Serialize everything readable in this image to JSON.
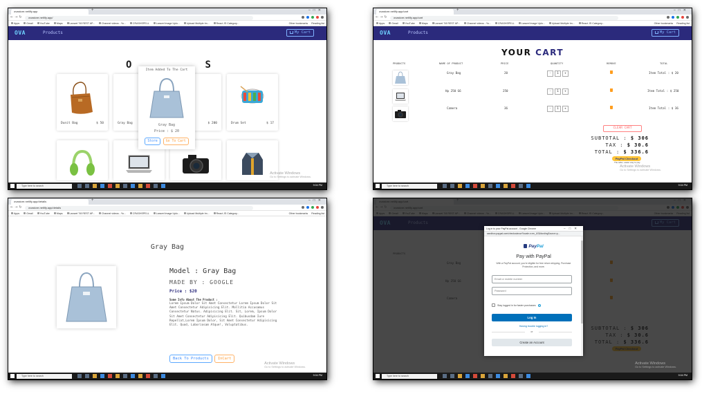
{
  "browser": {
    "tab_title_p1": "ovastore.netlify.app",
    "tab_title_p2": "ovastore.netlify.app/cart",
    "tab_title_p3": "ovastore.netlify.app/details",
    "url_p1": "ovastore.netlify.app/",
    "url_p2": "ovastore.netlify.app/cart",
    "url_p3": "ovastore.netlify.app/details",
    "url_p4": "ovastore.netlify.app/cart",
    "bookmarks": [
      "Apps",
      "Gmail",
      "YouTube",
      "Maps",
      "Laravel 7/8 REST AP...",
      "Channel videos - Yo...",
      "CRASHSPELL",
      "Laravel Image Uplo...",
      "Upload Multiple Im...",
      "React JS Category..."
    ],
    "bookmarks_right": [
      "Other bookmarks",
      "Reading list"
    ],
    "taskbar_search": "Type here to search",
    "clock": "9:04 PM",
    "activate_title": "Activate Windows",
    "activate_sub": "Go to Settings to activate Windows."
  },
  "nav": {
    "logo": "OVA",
    "products_link": "Products",
    "cart_button": "My Cart"
  },
  "products_page": {
    "title": "OUR PRODUCTS",
    "title_prefix": "O",
    "title_suffix": "S",
    "cards": [
      {
        "name": "Dunit Bag",
        "price": "$ 50"
      },
      {
        "name": "Gray Bag",
        "price": "$ 20"
      },
      {
        "name": "Camera",
        "price": "$ 200"
      },
      {
        "name": "Drum Set",
        "price": "$ 17"
      }
    ],
    "popup": {
      "message": "Item Added To The Cart",
      "name": "Gray Bag",
      "price": "Price : $ 20",
      "store_button": "Store",
      "go_cart_button": "Go To Cart"
    }
  },
  "cart_page": {
    "title_part1": "YOUR",
    "title_part2": "CART",
    "headers": [
      "PRODUCTS",
      "NAME OF PRODUCT",
      "PRICE",
      "QUANTITY",
      "REMOVE",
      "TOTAL"
    ],
    "rows": [
      {
        "name": "Gray Bag",
        "price": "20",
        "qty": "1",
        "total": "Item Total : $ 20"
      },
      {
        "name": "Hp 250 G6",
        "price": "250",
        "qty": "1",
        "total": "Item Total : $ 250"
      },
      {
        "name": "Camera",
        "price": "36",
        "qty": "1",
        "total": "Item Total : $ 36"
      }
    ],
    "qty_minus": "-",
    "qty_plus": "+",
    "clear_button": "CLEAR CART",
    "subtotal_label": "SUBTOTAL :",
    "subtotal_value": "$ 306",
    "tax_label": "TAX :",
    "tax_value": "$ 30.6",
    "total_label": "TOTAL :",
    "total_value": "$ 336.6",
    "paypal_button": "PayPal Checkout",
    "paypal_sub": "The safer, easier way to pay"
  },
  "details_page": {
    "title": "Gray Bag",
    "model": "Model : Gray Bag",
    "made_by": "MADE BY : GOOGLE",
    "price_label": "Price :",
    "price_value": "$20",
    "info_label": "Some Info About The Product :",
    "description": "Lorem Ipsum Dolor Sit Amet Consectetur Lorem Ipsum Dolor Sit Amet Consectetur Adipisicing Elit. Mollitia Accusamus Consectetur Natus. Adipisicing Elit. Sit, Lorem, Ipsum Dolor Sit Amet Consectetur Adipisicing Elit. Quibusdam Iure Repellat,Lorem Ipsum Dolor, Sit Amet Consectetur Adipisicing Elit. Quod, Laboriosam Atque!, Voluptatibus.",
    "back_button": "Back To Products",
    "add_button": "InCart"
  },
  "paypal_dialog": {
    "window_title": "Log in to your PayPal account - Google Chrome",
    "url": "sandbox.paypal.com/checkoutnow?locale.x=en_US&fundingSource=p...",
    "logo_pay": "Pay",
    "logo_pal": "Pal",
    "heading": "Pay with PayPal",
    "subtext": "With a PayPal account, you're eligible for free return shipping, Purchase Protection, and more.",
    "email_placeholder": "Email or mobile number",
    "password_placeholder": "Password",
    "stay_logged": "Stay logged in for faster purchases",
    "login_button": "Log In",
    "trouble_link": "Having trouble logging in?",
    "or_text": "or",
    "create_button": "Create an Account"
  }
}
